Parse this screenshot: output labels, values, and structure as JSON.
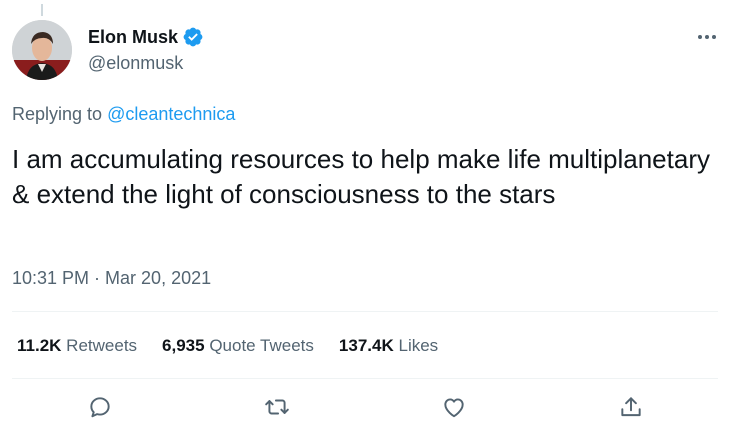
{
  "author": {
    "display_name": "Elon Musk",
    "handle": "@elonmusk",
    "verified": true
  },
  "reply": {
    "prefix": "Replying to ",
    "mention": "@cleantechnica"
  },
  "tweet": {
    "text": "I am accumulating resources to help make life multiplanetary & extend the light of consciousness to the stars",
    "timestamp": "10:31 PM · Mar 20, 2021"
  },
  "stats": {
    "retweets_count": "11.2K",
    "retweets_label": "Retweets",
    "quotes_count": "6,935",
    "quotes_label": "Quote Tweets",
    "likes_count": "137.4K",
    "likes_label": "Likes"
  },
  "icons": {
    "more": "more-dots-icon",
    "verified": "verified-badge-icon",
    "reply": "reply-icon",
    "retweet": "retweet-icon",
    "like": "heart-icon",
    "share": "share-icon"
  },
  "colors": {
    "accent": "#1d9bf0",
    "secondary_text": "#536471",
    "primary_text": "#0f1419"
  }
}
